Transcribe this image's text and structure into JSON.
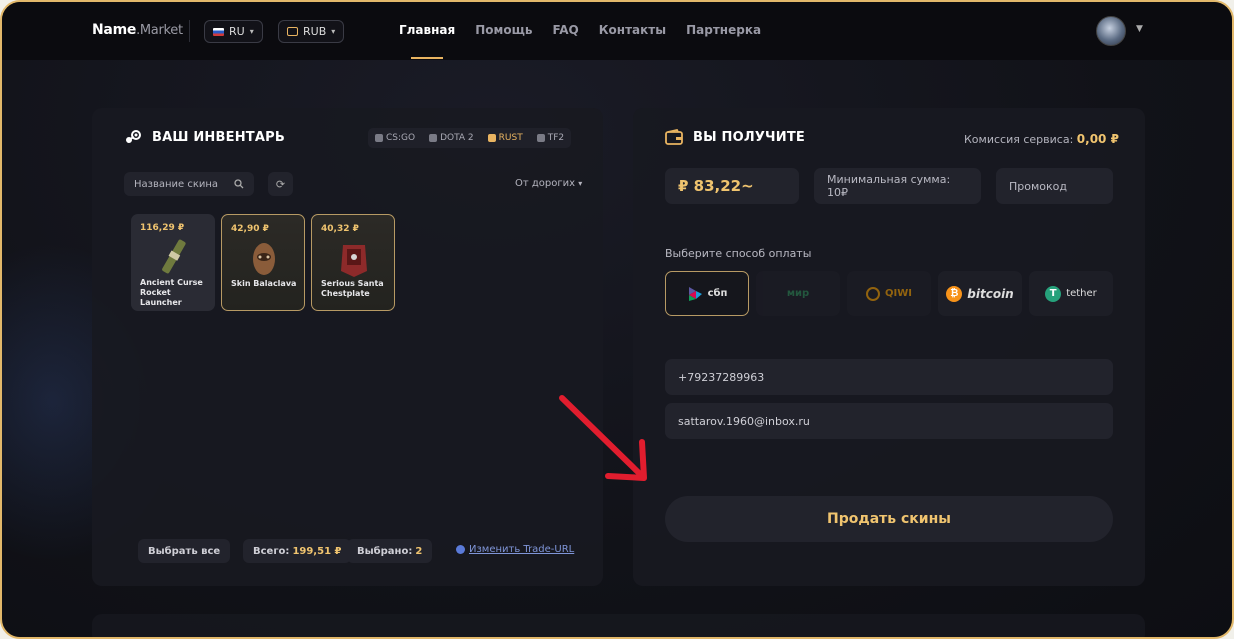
{
  "header": {
    "logo_main": "Name",
    "logo_sub": ".Market",
    "language": "RU",
    "currency": "RUB",
    "nav": [
      "Главная",
      "Помощь",
      "FAQ",
      "Контакты",
      "Партнерка"
    ],
    "accent_color": "#e9b461"
  },
  "inventory": {
    "title": "ВАШ ИНВЕНТАРЬ",
    "games": [
      "CS:GO",
      "DOTA 2",
      "RUST",
      "TF2"
    ],
    "active_game": "RUST",
    "search_placeholder": "Название скина",
    "sort_label": "От дорогих",
    "items": [
      {
        "price": "116,29 ₽",
        "name": "Ancient Curse Rocket Launcher"
      },
      {
        "price": "42,90 ₽",
        "name": "Skin Balaclava"
      },
      {
        "price": "40,32 ₽",
        "name": "Serious Santa Chestplate"
      }
    ],
    "select_all": "Выбрать все",
    "total_label": "Всего:",
    "total_value": "199,51 ₽",
    "selected_label": "Выбрано:",
    "selected_value": "2",
    "trade_url": "Изменить Trade-URL"
  },
  "receive": {
    "title": "ВЫ ПОЛУЧИТЕ",
    "commission_label": "Комиссия сервиса:",
    "commission_value": "0,00 ₽",
    "amount": "₽ 83,22~",
    "min_sum": "Минимальная сумма: 10₽",
    "promo_placeholder": "Промокод",
    "payment_label": "Выберите способ оплаты",
    "payment_methods": [
      "сбп",
      "мир",
      "QIWI",
      "bitcoin",
      "tether"
    ],
    "phone": "+79237289963",
    "email": "sattarov.1960@inbox.ru",
    "sell_button": "Продать скины"
  }
}
